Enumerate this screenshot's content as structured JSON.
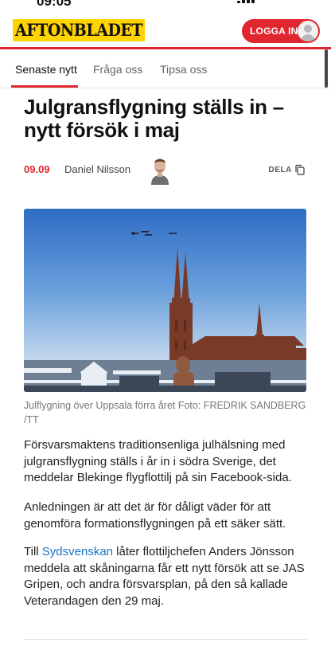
{
  "status_bar": {
    "time": "09:05"
  },
  "header": {
    "logo_text": "AFTONBLADET",
    "login_label": "LOGGA IN",
    "brand_color": "#e0262e",
    "logo_bg": "#ffd400"
  },
  "tabs": [
    {
      "label": "Senaste nytt",
      "active": true
    },
    {
      "label": "Fråga oss",
      "active": false
    },
    {
      "label": "Tipsa oss",
      "active": false
    }
  ],
  "article": {
    "title": "Julgransflygning ställs in – nytt försök i maj",
    "date": "09.09",
    "author": "Daniel Nilsson",
    "share_label": "DELA",
    "image_caption": "Julflygning över Uppsala förra året Foto: FREDRIK SANDBERG /TT",
    "paragraphs": {
      "p1": "Försvarsmaktens traditionsenliga julhälsning med julgransflygning ställs i år in i södra Sverige, det meddelar Blekinge flygflottilj på sin Facebook-sida.",
      "p2": "Anledningen är att det är för dåligt väder för att genomföra formationsflygningen på ett säker sätt.",
      "p3_prefix": "Till ",
      "p3_link": "Sydsvenskan",
      "p3_suffix": " låter flottiljchefen Anders Jönsson meddela att skåningarna får ett nytt försök att se JAS Gripen, och andra försvarsplan, på den så kallade Veterandagen den 29 maj."
    }
  },
  "icons": {
    "share": "copy-icon",
    "avatar": "user-icon"
  }
}
